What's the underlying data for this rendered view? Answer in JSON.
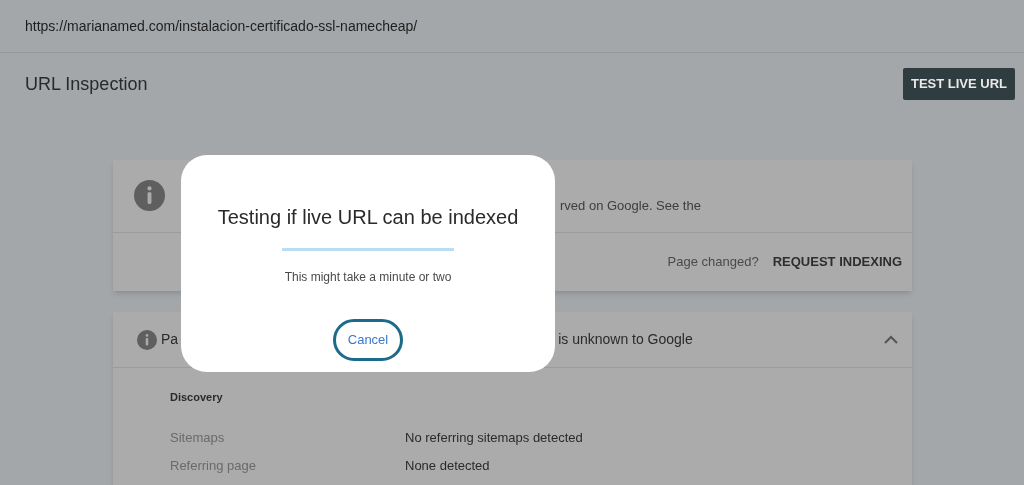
{
  "url_bar": {
    "url": "https://marianamed.com/instalacion-certificado-ssl-namecheap/"
  },
  "header": {
    "title": "URL Inspection",
    "button": "TEST LIVE URL"
  },
  "status_card": {
    "description_fragment": "rved on Google. See the",
    "footer_label": "Page changed?",
    "footer_action": "REQUEST INDEXING"
  },
  "coverage_card": {
    "title_start": "Pa",
    "title_end": "is unknown to Google",
    "expanded": true,
    "section": "Discovery",
    "rows": [
      {
        "label": "Sitemaps",
        "value": "No referring sitemaps detected"
      },
      {
        "label": "Referring page",
        "value": "None detected"
      }
    ]
  },
  "dialog": {
    "title": "Testing if live URL can be indexed",
    "message": "This might take a minute or two",
    "level": 1,
    "button": "Cancel"
  }
}
